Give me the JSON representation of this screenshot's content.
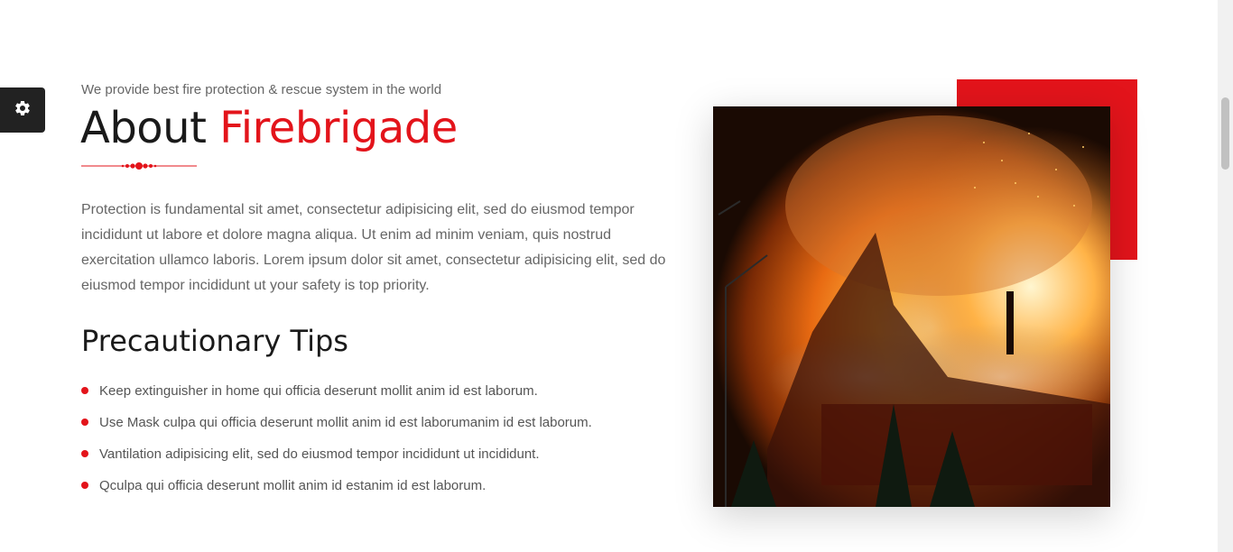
{
  "settings": {
    "icon": "gear-icon"
  },
  "about": {
    "subtitle": "We provide best fire protection & rescue system in the world",
    "title_main": "About ",
    "title_accent": "Firebrigade",
    "text": "Protection is fundamental sit amet, consectetur adipisicing elit, sed do eiusmod tempor incididunt ut labore et dolore magna aliqua. Ut enim ad minim veniam, quis nostrud exercitation ullamco laboris. Lorem ipsum dolor sit amet, consectetur adipisicing elit, sed do eiusmod tempor incididunt ut your safety is top priority."
  },
  "tips": {
    "heading": "Precautionary Tips",
    "items": [
      "Keep extinguisher in home qui officia deserunt mollit anim id est laborum.",
      "Use Mask culpa qui officia deserunt mollit anim id est laborumanim id est laborum.",
      "Vantilation adipisicing elit, sed do eiusmod tempor incididunt ut incididunt.",
      "Qculpa qui officia deserunt mollit anim id estanim id est laborum."
    ]
  },
  "colors": {
    "accent": "#e3141b",
    "heading": "#1a1a1a",
    "body_text": "#666666"
  }
}
